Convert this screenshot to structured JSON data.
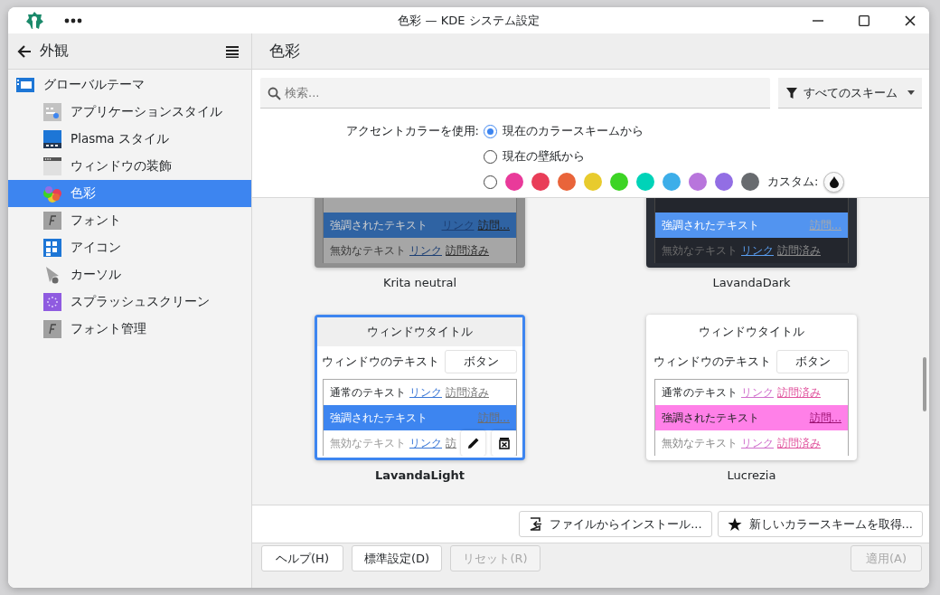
{
  "window": {
    "title": "色彩 — KDE システム設定"
  },
  "sidebar": {
    "title": "外観",
    "items": [
      {
        "label": "グローバルテーマ",
        "selected": false,
        "children": [
          {
            "label": "アプリケーションスタイル",
            "selected": false
          },
          {
            "label": "Plasma スタイル",
            "selected": false
          },
          {
            "label": "ウィンドウの装飾",
            "selected": false
          },
          {
            "label": "色彩",
            "selected": true
          },
          {
            "label": "フォント",
            "selected": false
          },
          {
            "label": "アイコン",
            "selected": false
          },
          {
            "label": "カーソル",
            "selected": false
          },
          {
            "label": "スプラッシュスクリーン",
            "selected": false
          },
          {
            "label": "フォント管理",
            "selected": false
          }
        ]
      }
    ]
  },
  "page": {
    "title": "色彩"
  },
  "search": {
    "placeholder": "検索..."
  },
  "filter": {
    "value": "すべてのスキーム"
  },
  "accent": {
    "label": "アクセントカラーを使用:",
    "options": [
      {
        "label": "現在のカラースキームから",
        "selected": true
      },
      {
        "label": "現在の壁紙から",
        "selected": false
      }
    ],
    "custom_choice": {
      "selected": false
    },
    "swatches": [
      {
        "color": "#e93a9a",
        "selected": false
      },
      {
        "color": "#e93d58",
        "selected": false
      },
      {
        "color": "#e9643a",
        "selected": false
      },
      {
        "color": "#e8cb2d",
        "selected": false
      },
      {
        "color": "#3dd425",
        "selected": false
      },
      {
        "color": "#00d3b8",
        "selected": false
      },
      {
        "color": "#3daee9",
        "selected": false
      },
      {
        "color": "#b875dc",
        "selected": false
      },
      {
        "color": "#926ee4",
        "selected": false
      },
      {
        "color": "#686b6f",
        "selected": false
      }
    ],
    "custom_label": "カスタム:"
  },
  "schemes": [
    {
      "name": "Krita neutral",
      "selected": false,
      "hovered": false,
      "preview": {
        "highlighted": {
          "text": "強調されたテキスト",
          "link": "リンク",
          "visited": "訪問..."
        },
        "inactive": {
          "text": "無効なテキスト",
          "link": "リンク",
          "visited": "訪問済み"
        }
      }
    },
    {
      "name": "LavandaDark",
      "selected": false,
      "hovered": false,
      "preview": {
        "highlighted": {
          "text": "強調されたテキスト",
          "visited": "訪問..."
        },
        "inactive": {
          "text": "無効なテキスト",
          "link": "リンク",
          "visited": "訪問済み"
        }
      }
    },
    {
      "name": "LavandaLight",
      "selected": true,
      "hovered": true,
      "title": "ウィンドウタイトル",
      "window_text": "ウィンドウのテキスト",
      "button": "ボタン",
      "preview": {
        "normal": {
          "text": "通常のテキスト",
          "link": "リンク",
          "visited": "訪問済み"
        },
        "highlighted": {
          "text": "強調されたテキスト",
          "visited": "訪問..."
        },
        "inactive": {
          "text": "無効なテキスト",
          "link": "リンク",
          "visited": "訪"
        }
      }
    },
    {
      "name": "Lucrezia",
      "selected": false,
      "hovered": false,
      "title": "ウィンドウタイトル",
      "window_text": "ウィンドウのテキスト",
      "button": "ボタン",
      "preview": {
        "normal": {
          "text": "通常のテキスト",
          "link": "リンク",
          "visited": "訪問済み"
        },
        "highlighted": {
          "text": "強調されたテキスト",
          "visited": "訪問..."
        },
        "inactive": {
          "text": "無効なテキスト",
          "link": "リンク",
          "visited": "訪問済み"
        }
      }
    }
  ],
  "install_buttons": [
    {
      "label": "ファイルからインストール..."
    },
    {
      "label": "新しいカラースキームを取得..."
    }
  ],
  "footer": {
    "buttons": [
      {
        "label": "ヘルプ(H)",
        "disabled": false
      },
      {
        "label": "標準設定(D)",
        "disabled": false
      },
      {
        "label": "リセット(R)",
        "disabled": true
      }
    ],
    "apply": {
      "label": "適用(A)",
      "disabled": true
    }
  }
}
